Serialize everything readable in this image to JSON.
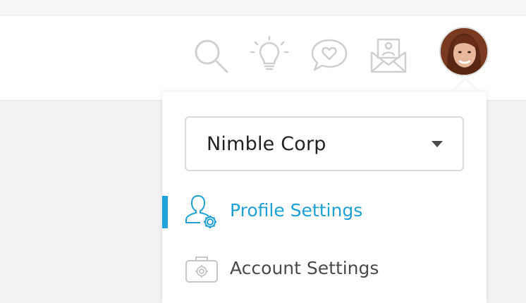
{
  "header": {
    "icons": [
      "search-icon",
      "lightbulb-icon",
      "chat-heart-icon",
      "contact-envelope-icon"
    ],
    "icon_color": "#d0d0d0"
  },
  "user": {
    "avatar": "user-avatar"
  },
  "dropdown": {
    "organization": "Nimble Corp",
    "items": [
      {
        "label": "Profile Settings",
        "icon": "profile-settings-icon",
        "active": true
      },
      {
        "label": "Account Settings",
        "icon": "briefcase-gear-icon",
        "active": false
      }
    ]
  },
  "colors": {
    "accent": "#1fa0d6",
    "text": "#4a4a4a",
    "header_bg": "#ffffff",
    "page_bg": "#f1f1f1"
  }
}
